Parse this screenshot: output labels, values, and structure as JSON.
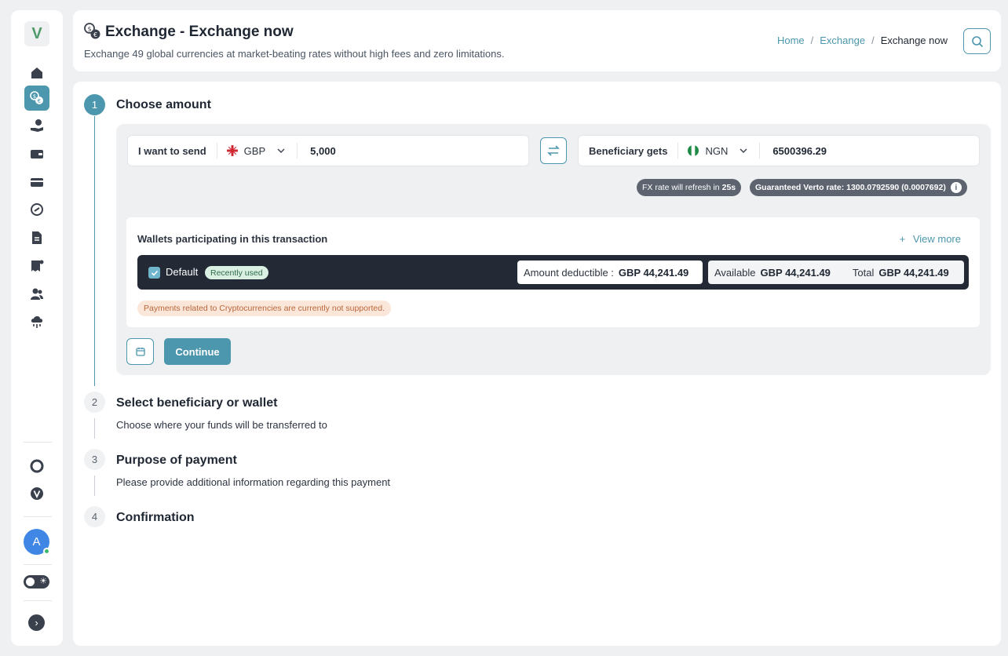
{
  "sidebar": {
    "logo": "V",
    "items": [
      {
        "icon": "home-icon"
      },
      {
        "icon": "exchange-icon",
        "active": true
      },
      {
        "icon": "hand-coin-icon"
      },
      {
        "icon": "wallet-icon"
      },
      {
        "icon": "card-icon"
      },
      {
        "icon": "link-icon"
      },
      {
        "icon": "transfer-doc-icon"
      },
      {
        "icon": "invoice-icon"
      },
      {
        "icon": "users-icon"
      },
      {
        "icon": "api-cloud-icon"
      }
    ],
    "avatar_initial": "A"
  },
  "header": {
    "title": "Exchange - Exchange now",
    "subtitle": "Exchange 49 global currencies at market-beating rates without high fees and zero limitations.",
    "breadcrumb": {
      "home": "Home",
      "sep": "/",
      "section": "Exchange",
      "current": "Exchange now"
    }
  },
  "steps": [
    {
      "number": "1",
      "title": "Choose amount"
    },
    {
      "number": "2",
      "title": "Select beneficiary or wallet",
      "description": "Choose where your funds will be transferred to"
    },
    {
      "number": "3",
      "title": "Purpose of payment",
      "description": "Please provide additional information regarding this payment"
    },
    {
      "number": "4",
      "title": "Confirmation"
    }
  ],
  "send": {
    "label": "I want to send",
    "currency": "GBP",
    "amount": "5,000"
  },
  "receive": {
    "label": "Beneficiary gets",
    "currency": "NGN",
    "amount": "6500396.29"
  },
  "rates": {
    "refresh_text": "FX rate will refresh in",
    "refresh_seconds": "25s",
    "guaranteed_text": "Guaranteed Verto rate: 1300.0792590 (0.0007692)"
  },
  "wallets": {
    "heading": "Wallets participating in this transaction",
    "view_more": "View more",
    "default_wallet": {
      "name": "Default",
      "badge": "Recently used",
      "deductible_label": "Amount deductible :",
      "deductible_value": "GBP 44,241.49",
      "available_label": "Available",
      "available_value": "GBP 44,241.49",
      "total_label": "Total",
      "total_value": "GBP 44,241.49"
    },
    "crypto_note": "Payments related to Cryptocurrencies are currently not supported."
  },
  "actions": {
    "continue_label": "Continue"
  },
  "colors": {
    "accent": "#4c97ad",
    "dark_bar": "#232a36",
    "pill": "#5d6470"
  }
}
